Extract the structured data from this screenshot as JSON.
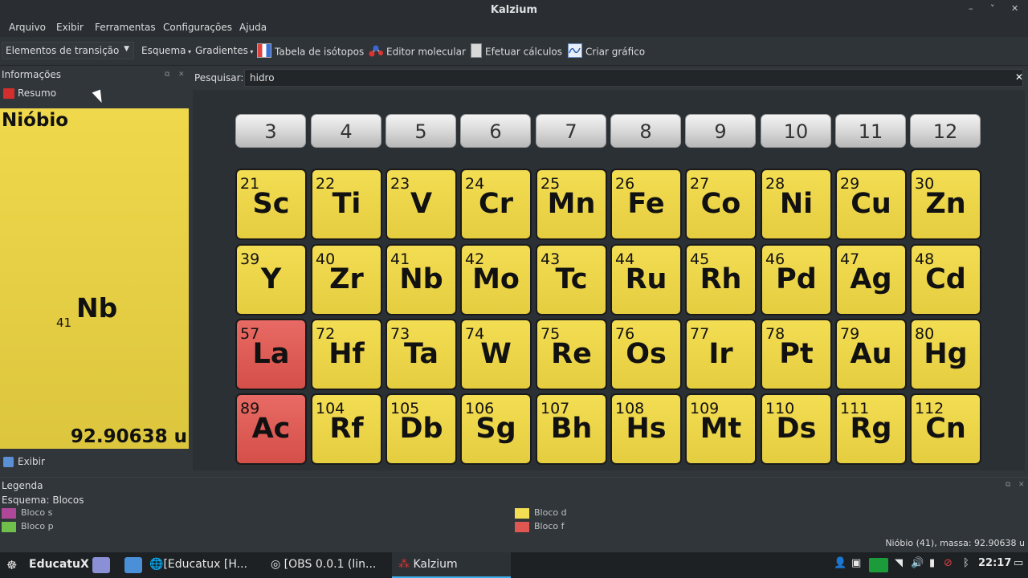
{
  "window": {
    "title": "Kalzium",
    "controls": [
      "–",
      "˅",
      "✕"
    ]
  },
  "menu": [
    "Arquivo",
    "Exibir",
    "Ferramentas",
    "Configurações",
    "Ajuda"
  ],
  "toolbar": {
    "combo_value": "Elementos de transição",
    "esquema": "Esquema",
    "gradientes": "Gradientes",
    "isotopos": "Tabela de isótopos",
    "editor": "Editor molecular",
    "calculos": "Efetuar cálculos",
    "grafico": "Criar gráfico"
  },
  "info_panel": {
    "title": "Informações",
    "resumo": "Resumo",
    "element_name": "Nióbio",
    "atomic_number": "41",
    "symbol": "Nb",
    "mass": "92.90638 u",
    "exibir": "Exibir"
  },
  "search": {
    "label": "Pesquisar:",
    "value": "hidro"
  },
  "groups": [
    "3",
    "4",
    "5",
    "6",
    "7",
    "8",
    "9",
    "10",
    "11",
    "12"
  ],
  "rows": [
    [
      {
        "n": "21",
        "s": "Sc",
        "b": "d"
      },
      {
        "n": "22",
        "s": "Ti",
        "b": "d"
      },
      {
        "n": "23",
        "s": "V",
        "b": "d"
      },
      {
        "n": "24",
        "s": "Cr",
        "b": "d"
      },
      {
        "n": "25",
        "s": "Mn",
        "b": "d"
      },
      {
        "n": "26",
        "s": "Fe",
        "b": "d"
      },
      {
        "n": "27",
        "s": "Co",
        "b": "d"
      },
      {
        "n": "28",
        "s": "Ni",
        "b": "d"
      },
      {
        "n": "29",
        "s": "Cu",
        "b": "d"
      },
      {
        "n": "30",
        "s": "Zn",
        "b": "d"
      }
    ],
    [
      {
        "n": "39",
        "s": "Y",
        "b": "d"
      },
      {
        "n": "40",
        "s": "Zr",
        "b": "d"
      },
      {
        "n": "41",
        "s": "Nb",
        "b": "d"
      },
      {
        "n": "42",
        "s": "Mo",
        "b": "d"
      },
      {
        "n": "43",
        "s": "Tc",
        "b": "d"
      },
      {
        "n": "44",
        "s": "Ru",
        "b": "d"
      },
      {
        "n": "45",
        "s": "Rh",
        "b": "d"
      },
      {
        "n": "46",
        "s": "Pd",
        "b": "d"
      },
      {
        "n": "47",
        "s": "Ag",
        "b": "d"
      },
      {
        "n": "48",
        "s": "Cd",
        "b": "d"
      }
    ],
    [
      {
        "n": "57",
        "s": "La",
        "b": "f"
      },
      {
        "n": "72",
        "s": "Hf",
        "b": "d"
      },
      {
        "n": "73",
        "s": "Ta",
        "b": "d"
      },
      {
        "n": "74",
        "s": "W",
        "b": "d"
      },
      {
        "n": "75",
        "s": "Re",
        "b": "d"
      },
      {
        "n": "76",
        "s": "Os",
        "b": "d"
      },
      {
        "n": "77",
        "s": "Ir",
        "b": "d"
      },
      {
        "n": "78",
        "s": "Pt",
        "b": "d"
      },
      {
        "n": "79",
        "s": "Au",
        "b": "d"
      },
      {
        "n": "80",
        "s": "Hg",
        "b": "d"
      }
    ],
    [
      {
        "n": "89",
        "s": "Ac",
        "b": "f"
      },
      {
        "n": "104",
        "s": "Rf",
        "b": "d"
      },
      {
        "n": "105",
        "s": "Db",
        "b": "d"
      },
      {
        "n": "106",
        "s": "Sg",
        "b": "d"
      },
      {
        "n": "107",
        "s": "Bh",
        "b": "d"
      },
      {
        "n": "108",
        "s": "Hs",
        "b": "d"
      },
      {
        "n": "109",
        "s": "Mt",
        "b": "d"
      },
      {
        "n": "110",
        "s": "Ds",
        "b": "d"
      },
      {
        "n": "111",
        "s": "Rg",
        "b": "d"
      },
      {
        "n": "112",
        "s": "Cn",
        "b": "d"
      }
    ]
  ],
  "legend": {
    "title": "Legenda",
    "scheme": "Esquema: Blocos",
    "items": [
      {
        "label": "Bloco s",
        "color": "#b0489a"
      },
      {
        "label": "Bloco p",
        "color": "#6fbf4a"
      },
      {
        "label": "Bloco d",
        "color": "#f3dd52"
      },
      {
        "label": "Bloco f",
        "color": "#e05752"
      }
    ]
  },
  "status": "Nióbio (41), massa: 92.90638 u",
  "taskbar": {
    "start": "EducatuX",
    "items": [
      "[Educatux [H...",
      "[OBS 0.0.1 (lin...",
      "Kalzium"
    ],
    "clock": "22:17"
  }
}
